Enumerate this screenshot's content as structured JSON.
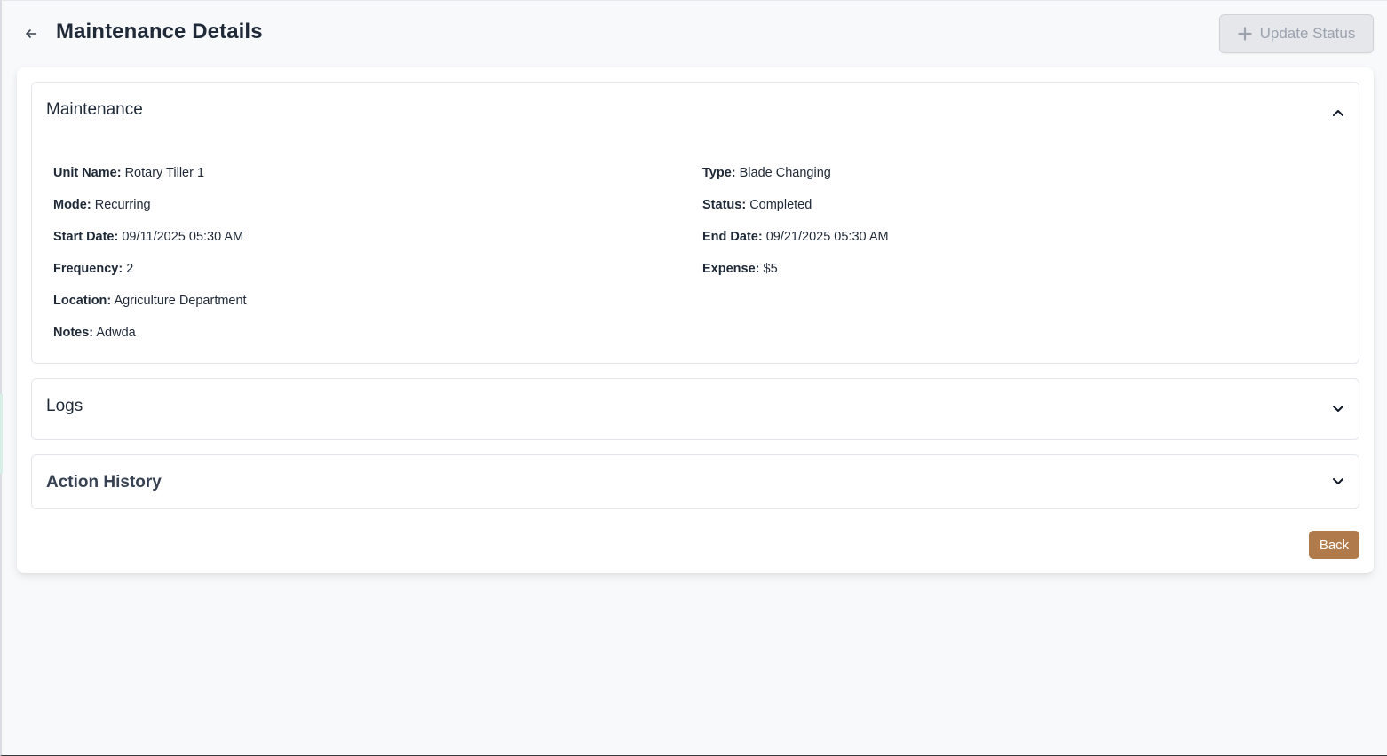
{
  "header": {
    "title": "Maintenance Details",
    "update_status_label": "Update Status"
  },
  "panels": {
    "maintenance": {
      "title": "Maintenance",
      "expanded": true,
      "fields": {
        "unit_name": {
          "label": "Unit Name:",
          "value": "Rotary Tiller 1"
        },
        "type": {
          "label": "Type:",
          "value": "Blade Changing"
        },
        "mode": {
          "label": "Mode:",
          "value": "Recurring"
        },
        "status": {
          "label": "Status:",
          "value": "Completed"
        },
        "start_date": {
          "label": "Start Date:",
          "value": "09/11/2025 05:30 AM"
        },
        "end_date": {
          "label": "End Date:",
          "value": "09/21/2025 05:30 AM"
        },
        "frequency": {
          "label": "Frequency:",
          "value": "2"
        },
        "expense": {
          "label": "Expense:",
          "value": "$5"
        },
        "location": {
          "label": "Location:",
          "value": "Agriculture Department"
        },
        "notes": {
          "label": "Notes:",
          "value": "Adwda"
        }
      }
    },
    "logs": {
      "title": "Logs",
      "expanded": false
    },
    "action_history": {
      "title": "Action History",
      "expanded": false
    }
  },
  "footer": {
    "back_label": "Back"
  },
  "colors": {
    "back_button": "#b07a4a",
    "disabled_button": "#e5e7eb",
    "page_background": "#f8f9fb"
  },
  "icons": {
    "back": "arrow-left-icon",
    "update": "plus-icon",
    "expand": "chevron-down-icon",
    "collapse": "chevron-up-icon"
  }
}
